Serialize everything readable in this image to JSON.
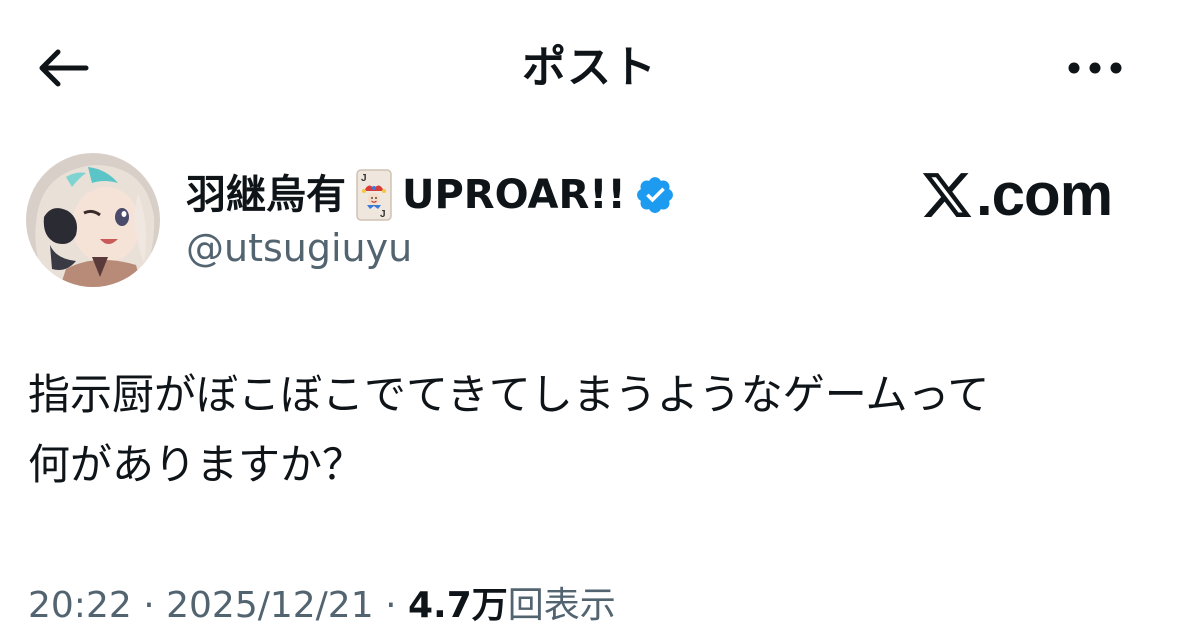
{
  "header": {
    "title": "ポスト",
    "back_icon": "arrow-left-icon",
    "more_icon": "more-horizontal-icon"
  },
  "author": {
    "display_name": "羽継烏有",
    "emoji": "joker-card-emoji",
    "team_name": "UPROAR!!",
    "verified": true,
    "verified_color": "#1d9bf0",
    "handle": "@utsugiuyu"
  },
  "watermark": {
    "text": ".com",
    "logo": "x-logo"
  },
  "post": {
    "text": "指示厨がぼこぼこでてきてしまうようなゲームって\n何がありますか？",
    "time": "20:22",
    "separator1": "·",
    "date": "2025/12/21",
    "separator2": "·",
    "views_count": "4.7万",
    "views_label": "回表示"
  },
  "colors": {
    "text_primary": "#0f1419",
    "text_secondary": "#536471",
    "verified_blue": "#1d9bf0",
    "background": "#ffffff"
  }
}
